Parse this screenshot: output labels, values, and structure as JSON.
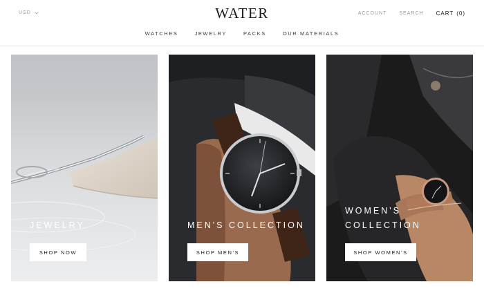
{
  "header": {
    "currency": "USD",
    "logo_text": "WATER",
    "account": "ACCOUNT",
    "search": "SEARCH",
    "cart_label": "CART",
    "cart_count": "(0)"
  },
  "nav": {
    "items": [
      "WATCHES",
      "JEWELRY",
      "PACKS",
      "OUR MATERIALS"
    ]
  },
  "collections": [
    {
      "title_line1": "JEWELRY",
      "button": "SHOP NOW"
    },
    {
      "title_line1": "MEN'S COLLECTION",
      "button": "SHOP MEN'S"
    },
    {
      "title_line1": "WOMEN'S",
      "title_line2": "COLLECTION",
      "button": "SHOP WOMEN'S"
    }
  ],
  "colors": {
    "text": "#1c1c1c",
    "muted": "#9a9a9a",
    "button_bg": "#ffffff"
  }
}
